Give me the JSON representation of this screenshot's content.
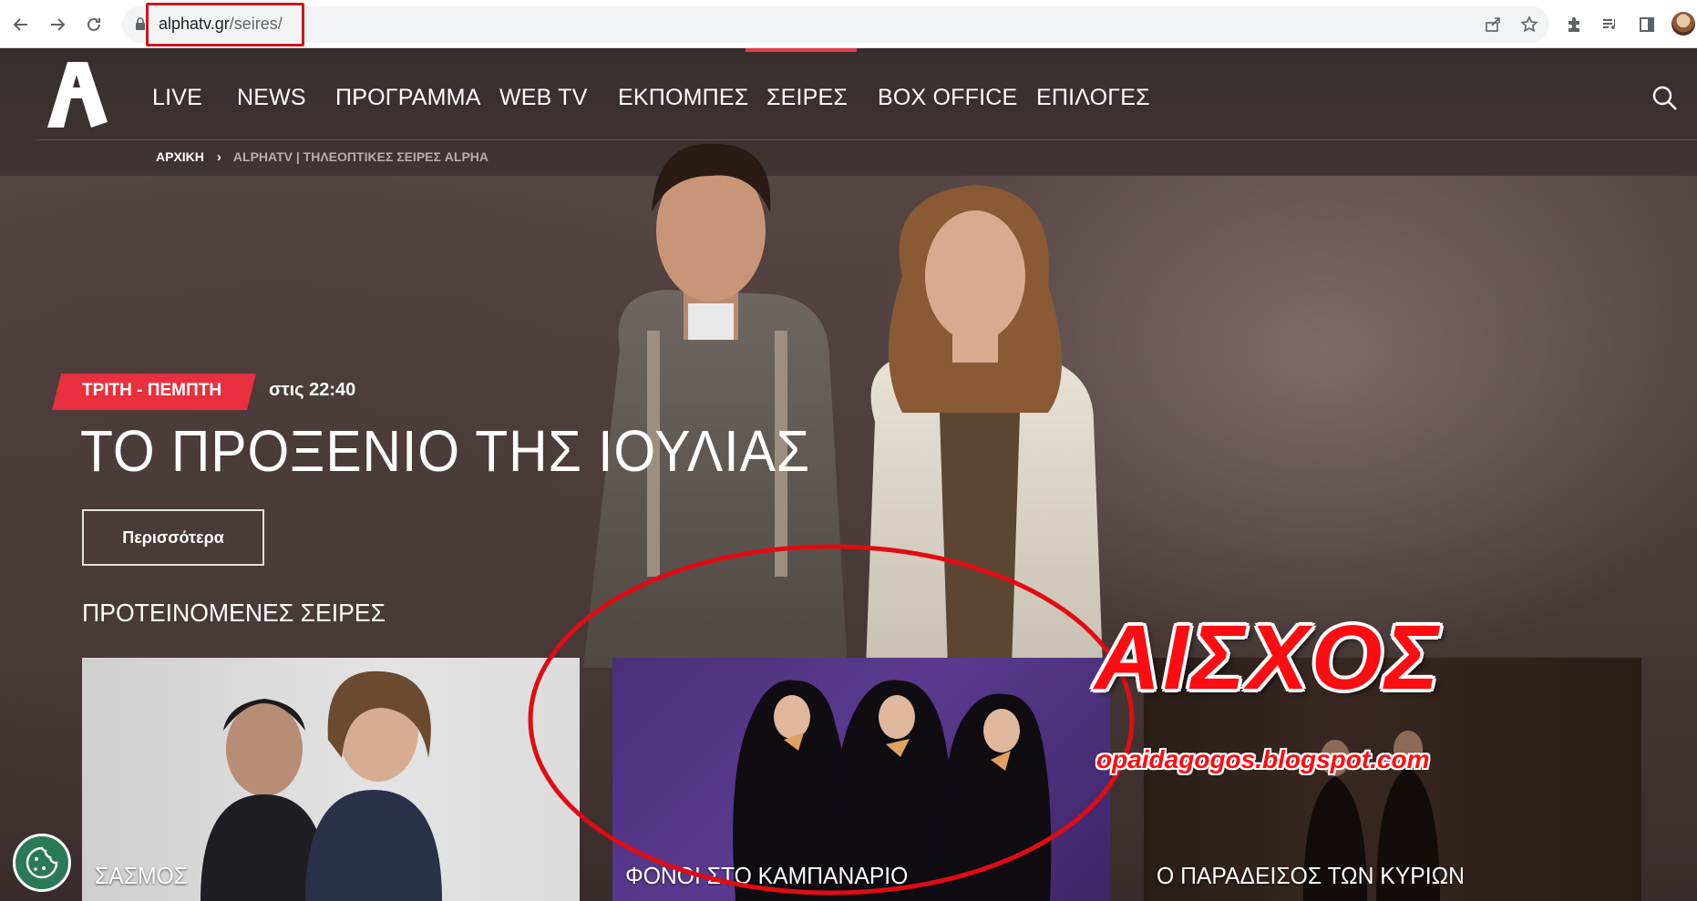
{
  "browser": {
    "url_host": "alphatv.gr",
    "url_path": "/seires/"
  },
  "site": {
    "menu": [
      {
        "label": "LIVE"
      },
      {
        "label": "NEWS"
      },
      {
        "label": "ΠΡΟΓΡΑΜΜΑ"
      },
      {
        "label": "WEB TV"
      },
      {
        "label": "ΕΚΠΟΜΠΕΣ"
      },
      {
        "label": "ΣΕΙΡΕΣ"
      },
      {
        "label": "BOX OFFICE"
      },
      {
        "label": "ΕΠΙΛΟΓΕΣ"
      }
    ],
    "breadcrumb": {
      "home": "ΑΡΧΙΚΗ",
      "current": "ALPHATV | ΤΗΛΕΟΠΤΙΚΕΣ ΣΕΙΡΕΣ ALPHA"
    },
    "hero": {
      "day_badge": "ΤΡΙΤΗ - ΠΕΜΠΤΗ",
      "air_time": "στις 22:40",
      "title": "ΤΟ ΠΡΟΞΕΝΙΟ ΤΗΣ ΙΟΥΛΙΑΣ",
      "more_button": "Περισσότερα"
    },
    "recommended": {
      "section_title": "ΠΡΟΤΕΙΝΟΜΕΝΕΣ ΣΕΙΡΕΣ",
      "cards": [
        {
          "title": "ΣΑΣΜΟΣ"
        },
        {
          "title": "ΦΟΝΟΙ ΣΤΟ ΚΑΜΠΑΝΑΡΙΟ"
        },
        {
          "title": "Ο ΠΑΡΑΔΕΙΣΟΣ ΤΩΝ ΚΥΡΙΩΝ"
        }
      ]
    }
  },
  "overlay": {
    "shame_text": "ΑΙΣΧΟΣ",
    "watermark": "opaidagogos.blogspot.com"
  },
  "colors": {
    "accent_red": "#e8303e",
    "overlay_red": "#ff0b12"
  }
}
